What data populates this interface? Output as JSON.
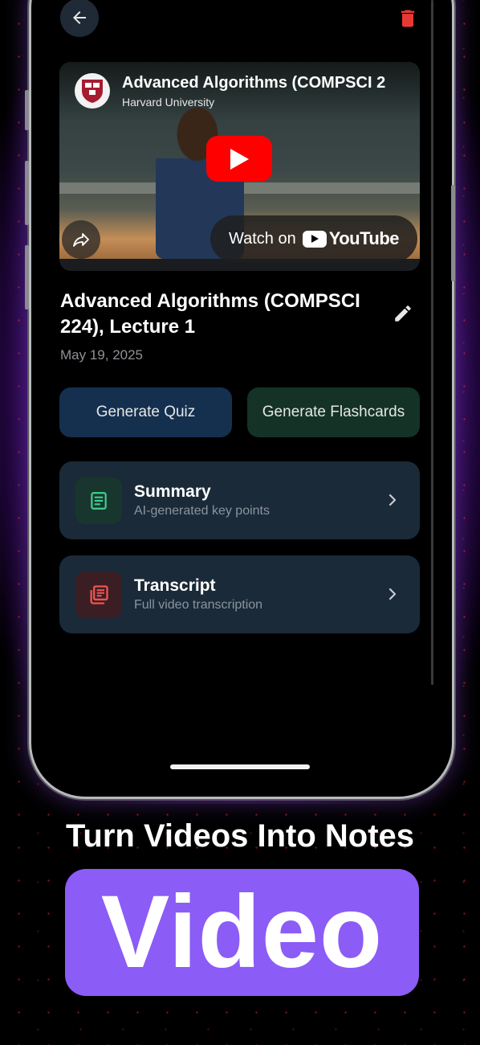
{
  "colors": {
    "accent_purple": "#8b5cf6",
    "quiz_button_bg": "#15304f",
    "flashcards_button_bg": "#143226",
    "card_bg": "#1b2a38",
    "trash_red": "#e53935",
    "youtube_red": "#ff0000"
  },
  "topbar": {
    "back_icon": "arrow-left-icon",
    "delete_icon": "trash-icon"
  },
  "video": {
    "title": "Advanced Algorithms (COMPSCI 2",
    "channel": "Harvard University",
    "watch_on_label": "Watch on",
    "youtube_label": "YouTube",
    "play_icon": "play-icon",
    "share_icon": "share-icon"
  },
  "lecture": {
    "title": "Advanced Algorithms (COMPSCI 224), Lecture 1",
    "date": "May 19, 2025",
    "edit_icon": "pencil-icon"
  },
  "actions": {
    "quiz_label": "Generate Quiz",
    "flashcards_label": "Generate Flashcards"
  },
  "cards": [
    {
      "title": "Summary",
      "subtitle": "AI-generated key points",
      "icon": "document-icon",
      "icon_color": "#3ecf8e",
      "icon_bg": "#18362d"
    },
    {
      "title": "Transcript",
      "subtitle": "Full video transcription",
      "icon": "transcript-icon",
      "icon_color": "#ef5350",
      "icon_bg": "#3a1e24"
    }
  ],
  "promo": {
    "tagline": "Turn Videos Into Notes",
    "big_word": "Video"
  }
}
